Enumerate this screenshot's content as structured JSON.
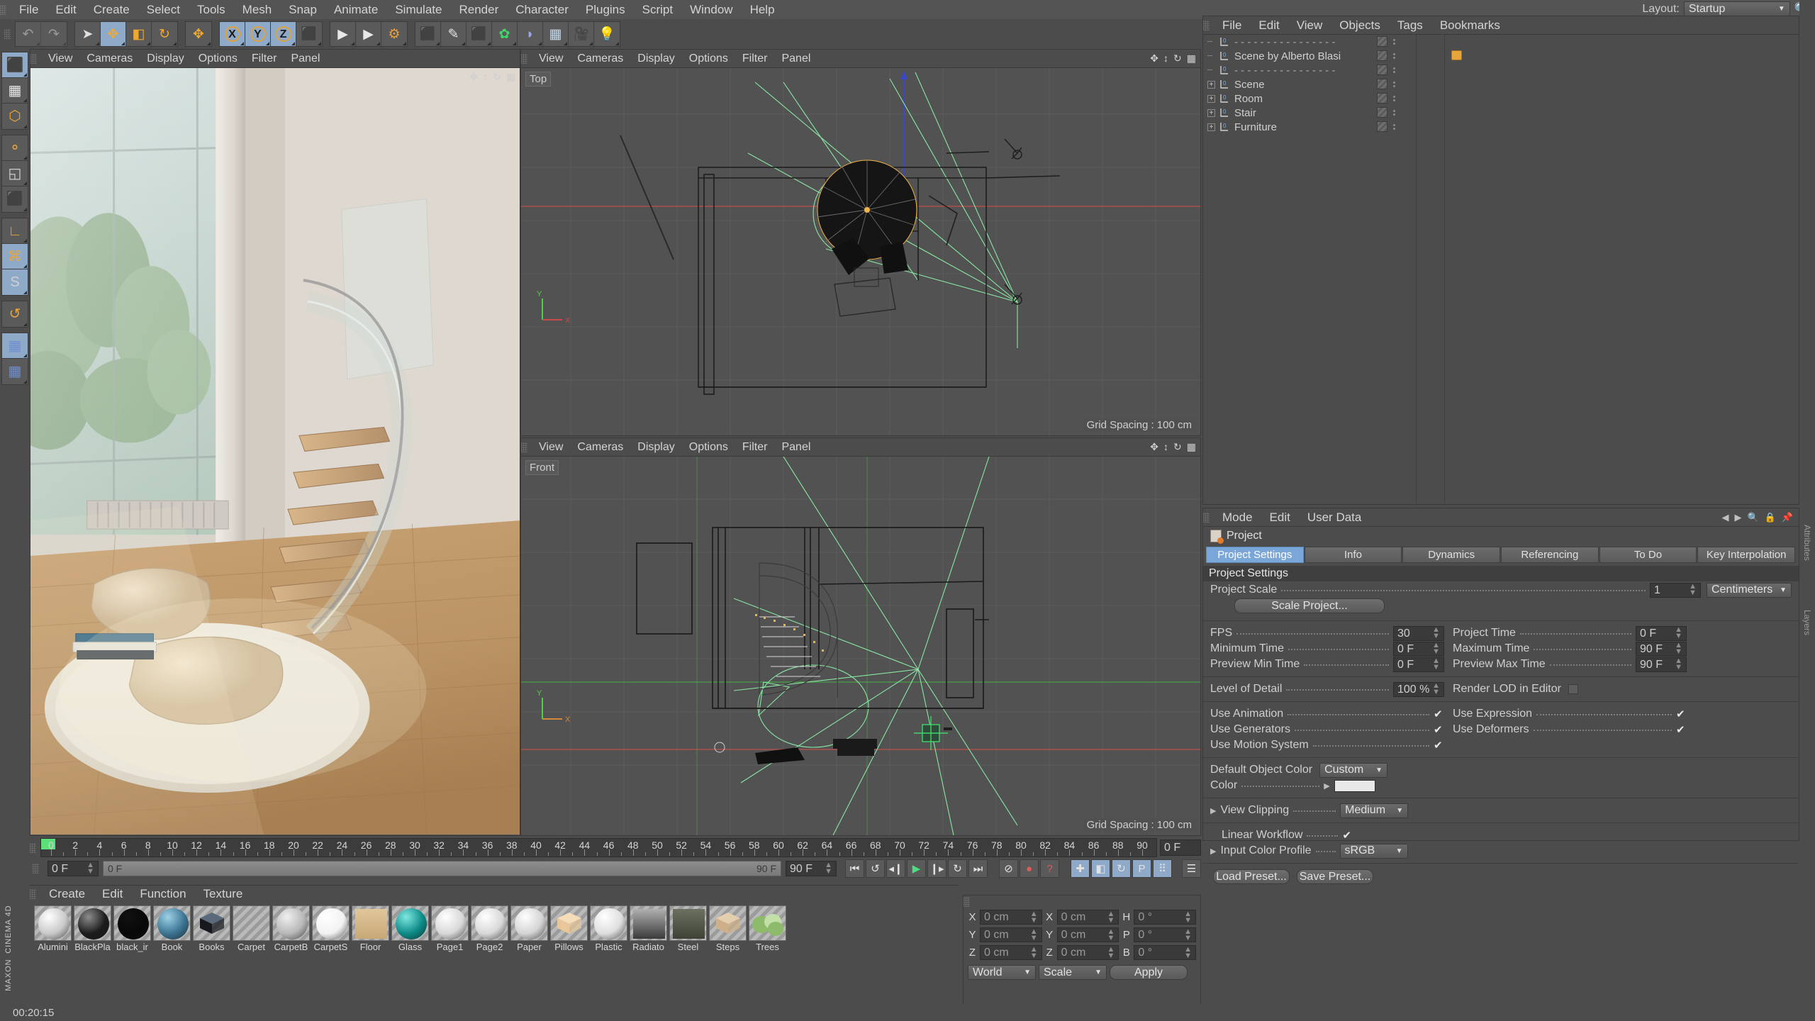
{
  "app": {
    "name": "CINEMA 4D",
    "brand_top": "MAXON",
    "status_time": "00:20:15"
  },
  "menubar": {
    "items": [
      "File",
      "Edit",
      "Create",
      "Select",
      "Tools",
      "Mesh",
      "Snap",
      "Animate",
      "Simulate",
      "Render",
      "Character",
      "Plugins",
      "Script",
      "Window",
      "Help"
    ],
    "layout_label": "Layout:",
    "layout_value": "Startup",
    "search_icon": "search-icon"
  },
  "toolbar": {
    "groups": [
      {
        "name": "undo-redo",
        "buttons": [
          {
            "icon": "undo-icon",
            "glyph": "↶",
            "state": "disabled"
          },
          {
            "icon": "redo-icon",
            "glyph": "↷",
            "state": "disabled"
          }
        ]
      },
      {
        "name": "transform-tools",
        "buttons": [
          {
            "icon": "live-selection-icon",
            "glyph": "➤",
            "state": "off"
          },
          {
            "icon": "move-icon",
            "glyph": "✥",
            "state": "on"
          },
          {
            "icon": "scale-icon",
            "glyph": "◧",
            "state": "off"
          },
          {
            "icon": "rotate-icon",
            "glyph": "↻",
            "state": "off"
          }
        ]
      },
      {
        "name": "move-duplicate",
        "buttons": [
          {
            "icon": "move-alt-icon",
            "glyph": "✥",
            "state": "off"
          }
        ]
      },
      {
        "name": "axis-locks",
        "buttons": [
          {
            "icon": "axis-x-icon",
            "glyph": "X",
            "state": "on"
          },
          {
            "icon": "axis-y-icon",
            "glyph": "Y",
            "state": "on"
          },
          {
            "icon": "axis-z-icon",
            "glyph": "Z",
            "state": "on"
          },
          {
            "icon": "world-object-axis-icon",
            "glyph": "⬛",
            "state": "off"
          }
        ]
      },
      {
        "name": "render-tools",
        "buttons": [
          {
            "icon": "render-view-icon",
            "glyph": "▶",
            "state": "off"
          },
          {
            "icon": "render-region-icon",
            "glyph": "▶",
            "state": "off"
          },
          {
            "icon": "render-settings-icon",
            "glyph": "⚙",
            "state": "off"
          }
        ]
      },
      {
        "name": "create-objects",
        "buttons": [
          {
            "icon": "cube-primitive-icon",
            "glyph": "⬛",
            "state": "off"
          },
          {
            "icon": "spline-pen-icon",
            "glyph": "✎",
            "state": "off"
          },
          {
            "icon": "nurbs-generator-icon",
            "glyph": "⬛",
            "state": "off"
          },
          {
            "icon": "mograph-icon",
            "glyph": "✿",
            "state": "off"
          },
          {
            "icon": "deformer-icon",
            "glyph": "◗",
            "state": "off"
          },
          {
            "icon": "environment-icon",
            "glyph": "▦",
            "state": "off"
          },
          {
            "icon": "camera-icon",
            "glyph": "🎥",
            "state": "off"
          },
          {
            "icon": "light-icon",
            "glyph": "💡",
            "state": "off"
          }
        ]
      }
    ]
  },
  "left_rail": {
    "groups": [
      {
        "buttons": [
          {
            "icon": "model-mode-icon",
            "state": "on"
          },
          {
            "icon": "texture-mode-icon",
            "state": "off"
          },
          {
            "icon": "polygon-mode-icon",
            "state": "off"
          }
        ]
      },
      {
        "buttons": [
          {
            "icon": "points-mode-icon",
            "state": "off"
          },
          {
            "icon": "edges-mode-icon",
            "state": "off"
          },
          {
            "icon": "polygons-mode-icon",
            "state": "off"
          }
        ]
      },
      {
        "buttons": [
          {
            "icon": "object-axis-icon",
            "state": "off"
          },
          {
            "icon": "viewport-solo-icon",
            "state": "on"
          },
          {
            "icon": "soft-selection-icon",
            "state": "on"
          }
        ]
      },
      {
        "buttons": [
          {
            "icon": "snap-magnet-icon",
            "state": "off"
          }
        ]
      },
      {
        "buttons": [
          {
            "icon": "workplane-lock-icon",
            "state": "on"
          },
          {
            "icon": "workplane-rotate-icon",
            "state": "off"
          }
        ]
      }
    ]
  },
  "viewports": {
    "menu_items": [
      "View",
      "Cameras",
      "Display",
      "Options",
      "Filter",
      "Panel"
    ],
    "perspective": {
      "name": "perspective-viewport",
      "label": ""
    },
    "top": {
      "name": "top-viewport",
      "label": "Top",
      "grid_spacing": "Grid Spacing : 100 cm"
    },
    "front": {
      "name": "front-viewport",
      "label": "Front",
      "grid_spacing": "Grid Spacing : 100 cm"
    }
  },
  "object_manager": {
    "menu_items": [
      "File",
      "Edit",
      "View",
      "Objects",
      "Tags",
      "Bookmarks"
    ],
    "rows": [
      {
        "name": "- - - - - - - - - - - - - - - -",
        "expandable": false,
        "tag": false,
        "dashed": true
      },
      {
        "name": "Scene by Alberto Blasi",
        "expandable": false,
        "tag": true,
        "dashed": false
      },
      {
        "name": "- - - - - - - - - - - - - - - -",
        "expandable": false,
        "tag": false,
        "dashed": true
      },
      {
        "name": "Scene",
        "expandable": true,
        "tag": false,
        "dashed": false
      },
      {
        "name": "Room",
        "expandable": true,
        "tag": false,
        "dashed": false
      },
      {
        "name": "Stair",
        "expandable": true,
        "tag": false,
        "dashed": false
      },
      {
        "name": "Furniture",
        "expandable": true,
        "tag": false,
        "dashed": false
      }
    ]
  },
  "attribute_manager": {
    "menu_items": [
      "Mode",
      "Edit",
      "User Data"
    ],
    "object_title": "Project",
    "tabs": [
      {
        "label": "Project Settings",
        "selected": true
      },
      {
        "label": "Info",
        "selected": false
      },
      {
        "label": "Dynamics",
        "selected": false
      },
      {
        "label": "Referencing",
        "selected": false
      },
      {
        "label": "To Do",
        "selected": false
      },
      {
        "label": "Key Interpolation",
        "selected": false
      }
    ],
    "section_title": "Project Settings",
    "project_scale": {
      "label": "Project Scale",
      "value": "1",
      "unit": "Centimeters"
    },
    "scale_project_button": "Scale Project...",
    "fields": [
      {
        "label": "FPS",
        "value": "30",
        "label2": "Project Time",
        "value2": "0 F"
      },
      {
        "label": "Minimum Time",
        "value": "0 F",
        "label2": "Maximum Time",
        "value2": "90 F"
      },
      {
        "label": "Preview Min Time",
        "value": "0 F",
        "label2": "Preview Max Time",
        "value2": "90 F"
      }
    ],
    "lod": {
      "label": "Level of Detail",
      "value": "100 %",
      "label2": "Render LOD in Editor",
      "checked2": false
    },
    "toggles": [
      {
        "label": "Use Animation",
        "checked": true,
        "label2": "Use Expression",
        "checked2": true
      },
      {
        "label": "Use Generators",
        "checked": true,
        "label2": "Use Deformers",
        "checked2": true
      },
      {
        "label": "Use Motion System",
        "checked": true,
        "label2": "",
        "checked2": null
      }
    ],
    "default_object_color": {
      "label": "Default Object Color",
      "value": "Custom"
    },
    "color": {
      "label": "Color",
      "hex": "#e8e8e8"
    },
    "view_clipping": {
      "label": "View Clipping",
      "value": "Medium"
    },
    "linear_workflow": {
      "label": "Linear Workflow",
      "checked": true
    },
    "input_color_profile": {
      "label": "Input Color Profile",
      "value": "sRGB"
    },
    "load_preset_button": "Load Preset...",
    "save_preset_button": "Save Preset..."
  },
  "timeline": {
    "ticks": [
      0,
      2,
      4,
      6,
      8,
      10,
      12,
      14,
      16,
      18,
      20,
      22,
      24,
      26,
      28,
      30,
      32,
      34,
      36,
      38,
      40,
      42,
      44,
      46,
      48,
      50,
      52,
      54,
      56,
      58,
      60,
      62,
      64,
      66,
      68,
      70,
      72,
      74,
      76,
      78,
      80,
      82,
      84,
      86,
      88,
      90
    ],
    "min_frame": 0,
    "max_frame": 90,
    "end_frame_box": "0 F",
    "current_frame_field": "0 F",
    "slider_left_label": "0 F",
    "slider_right_label": "90 F",
    "preview_max_field": "90 F",
    "transport": [
      {
        "icon": "go-to-start-icon",
        "glyph": "⏮"
      },
      {
        "icon": "step-back-keyframe-icon",
        "glyph": "↺"
      },
      {
        "icon": "step-back-frame-icon",
        "glyph": "◂❙"
      },
      {
        "icon": "play-icon",
        "glyph": "▶"
      },
      {
        "icon": "step-forward-frame-icon",
        "glyph": "❙▸"
      },
      {
        "icon": "step-forward-keyframe-icon",
        "glyph": "↻"
      },
      {
        "icon": "go-to-end-icon",
        "glyph": "⏭"
      }
    ],
    "record_group": [
      {
        "icon": "autokey-icon",
        "glyph": "⊘"
      },
      {
        "icon": "record-active-objects-icon",
        "glyph": "●"
      },
      {
        "icon": "keyframe-selection-icon",
        "glyph": "?"
      }
    ],
    "key_toggles": [
      {
        "icon": "position-key-icon",
        "glyph": "✚",
        "on": true
      },
      {
        "icon": "scale-key-icon",
        "glyph": "◧",
        "on": true
      },
      {
        "icon": "rotation-key-icon",
        "glyph": "↻",
        "on": true
      },
      {
        "icon": "pla-key-icon",
        "glyph": "P",
        "on": true
      },
      {
        "icon": "point-level-anim-icon",
        "glyph": "⠿",
        "on": true
      }
    ]
  },
  "material_manager": {
    "menu_items": [
      "Create",
      "Edit",
      "Function",
      "Texture"
    ],
    "materials": [
      {
        "label": "Alumini",
        "type": "sphere",
        "color": "#c9c9c9",
        "hilite": "#ffffff"
      },
      {
        "label": "BlackPla",
        "type": "sphere",
        "color": "#1c1c1c",
        "hilite": "#8d8d8d"
      },
      {
        "label": "black_ir",
        "type": "sphere",
        "color": "#080808",
        "hilite": "#111111"
      },
      {
        "label": "Book",
        "type": "sphere",
        "color": "#3b7391",
        "hilite": "#9fd2e8"
      },
      {
        "label": "Books",
        "type": "cube",
        "color": "#16181c",
        "hilite": "#5a6a7a"
      },
      {
        "label": "Carpet",
        "type": "none",
        "color": "#aaaaaa",
        "hilite": "#ffffff"
      },
      {
        "label": "CarpetB",
        "type": "sphere",
        "color": "#b8b8b8",
        "hilite": "#efefef"
      },
      {
        "label": "CarpetS",
        "type": "sphere",
        "color": "#f2f2f2",
        "hilite": "#ffffff"
      },
      {
        "label": "Floor",
        "type": "plane",
        "color": "#c8a877",
        "hilite": "#e0c79b"
      },
      {
        "label": "Glass",
        "type": "sphere",
        "color": "#0d8a86",
        "hilite": "#7fe8e2"
      },
      {
        "label": "Page1",
        "type": "sphere",
        "color": "#d8d8d8",
        "hilite": "#ffffff"
      },
      {
        "label": "Page2",
        "type": "sphere",
        "color": "#d8d8d8",
        "hilite": "#ffffff"
      },
      {
        "label": "Paper",
        "type": "sphere",
        "color": "#d4d4d4",
        "hilite": "#ffffff"
      },
      {
        "label": "Pillows",
        "type": "cube",
        "color": "#e8c89a",
        "hilite": "#f4ddb8"
      },
      {
        "label": "Plastic",
        "type": "sphere",
        "color": "#dedede",
        "hilite": "#ffffff"
      },
      {
        "label": "Radiato",
        "type": "plane",
        "color": "#3a3a3a",
        "hilite": "#b0b0b0"
      },
      {
        "label": "Steel",
        "type": "plane",
        "color": "#3e4236",
        "hilite": "#6b7060"
      },
      {
        "label": "Steps",
        "type": "cube",
        "color": "#cdb089",
        "hilite": "#e3ceae"
      },
      {
        "label": "Trees",
        "type": "foliage",
        "color": "#8dbb6b",
        "hilite": "#c2dfa8"
      }
    ]
  },
  "coordinate_manager": {
    "position": {
      "x": "0 cm",
      "y": "0 cm",
      "z": "0 cm"
    },
    "size": {
      "x": "0 cm",
      "y": "0 cm",
      "z": "0 cm"
    },
    "rotation": {
      "h": "0 °",
      "p": "0 °",
      "b": "0 °"
    },
    "axis_labels_left": [
      "X",
      "Y",
      "Z"
    ],
    "axis_labels_mid": [
      "X",
      "Y",
      "Z"
    ],
    "axis_labels_right": [
      "H",
      "P",
      "B"
    ],
    "coord_system": "World",
    "size_mode": "Scale",
    "apply_button": "Apply"
  },
  "right_strip": {
    "labels": [
      "Attributes",
      "Layers"
    ]
  },
  "colors": {
    "bg": "#4c4c4c",
    "panel": "#4c4c4c",
    "accent_blue": "#7ba7d8",
    "accent_orange": "#e89a2b",
    "viewport": "#525252",
    "green_helper": "#8cf0a8",
    "time_green": "#5de07a"
  }
}
